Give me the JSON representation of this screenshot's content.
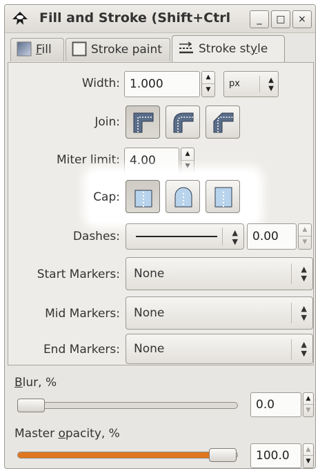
{
  "window": {
    "title": "Fill and Stroke (Shift+Ctrl",
    "buttons": {
      "minimize": "_",
      "maximize": "□",
      "close": "×"
    }
  },
  "tabs": [
    {
      "label": "Fill",
      "mnemonic": "F",
      "rest": "ill",
      "icon": "fill-swatch-icon",
      "active": false
    },
    {
      "label": "Stroke paint",
      "icon": "stroke-paint-swatch-icon",
      "active": false
    },
    {
      "label": "Stroke style",
      "mnemonic": "y",
      "prefix": "Stroke st",
      "suffix": "le",
      "icon": "stroke-style-icon",
      "active": true
    }
  ],
  "stroke_style": {
    "width": {
      "label": "Width:",
      "value": "1.000",
      "unit": "px"
    },
    "join": {
      "label": "Join:",
      "options": [
        "miter",
        "round",
        "bevel"
      ],
      "selected": "miter"
    },
    "miter_limit": {
      "label": "Miter limit:",
      "value": "4.00"
    },
    "cap": {
      "label": "Cap:",
      "options": [
        "butt",
        "round",
        "square"
      ],
      "selected": "butt",
      "highlighted": true
    },
    "dashes": {
      "label": "Dashes:",
      "offset": "0.00"
    },
    "start_markers": {
      "label": "Start Markers:",
      "value": "None"
    },
    "mid_markers": {
      "label": "Mid Markers:",
      "value": "None"
    },
    "end_markers": {
      "label": "End Markers:",
      "value": "None"
    }
  },
  "blur": {
    "label": "Blur, %",
    "mnemonic": "B",
    "rest": "lur, %",
    "value": "0.0",
    "level": 0.0
  },
  "opacity": {
    "label": "Master opacity, %",
    "pre": "Master ",
    "mnemonic": "o",
    "rest": "pacity, %",
    "value": "100.0",
    "level": 1.0
  },
  "colors": {
    "accent_slider": "#e0761f",
    "cap_highlight": "#ffffff"
  }
}
